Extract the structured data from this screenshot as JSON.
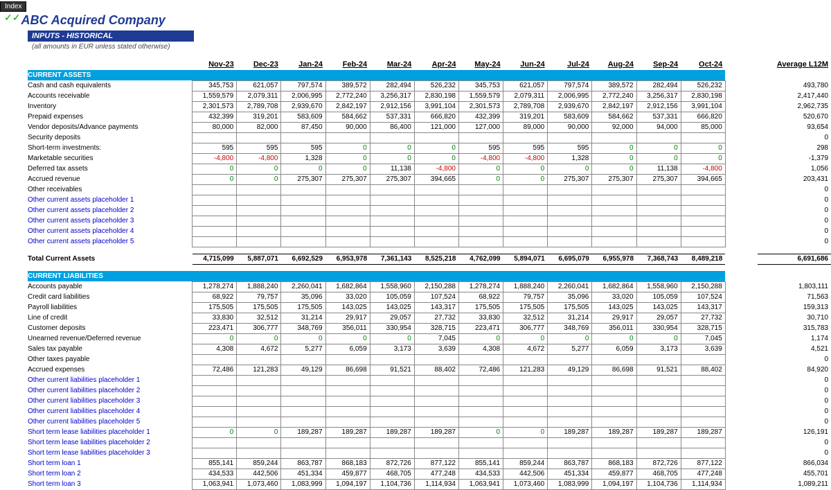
{
  "index_btn": "Index",
  "company": "ABC Acquired Company",
  "section_title": "INPUTS - HISTORICAL",
  "section_sub": "(all amounts in EUR unless stated otherwise)",
  "checks": "✓✓",
  "headers": [
    "Nov-23",
    "Dec-23",
    "Jan-24",
    "Feb-24",
    "Mar-24",
    "Apr-24",
    "May-24",
    "Jun-24",
    "Jul-24",
    "Aug-24",
    "Sep-24",
    "Oct-24"
  ],
  "avg_label": "Average L12M",
  "current_assets_hdr": "CURRENT ASSETS",
  "current_liab_hdr": "CURRENT LIABILITIES",
  "total_ca_label": "Total Current Assets",
  "rows_ca": [
    {
      "label": "Cash and cash equivalents",
      "link": false,
      "vals": [
        "345,753",
        "621,057",
        "797,574",
        "389,572",
        "282,494",
        "526,232",
        "345,753",
        "621,057",
        "797,574",
        "389,572",
        "282,494",
        "526,232"
      ],
      "avg": "493,780"
    },
    {
      "label": "Accounts receivable",
      "link": false,
      "vals": [
        "1,559,579",
        "2,079,311",
        "2,006,995",
        "2,772,240",
        "3,256,317",
        "2,830,198",
        "1,559,579",
        "2,079,311",
        "2,006,995",
        "2,772,240",
        "3,256,317",
        "2,830,198"
      ],
      "avg": "2,417,440"
    },
    {
      "label": "Inventory",
      "link": false,
      "vals": [
        "2,301,573",
        "2,789,708",
        "2,939,670",
        "2,842,197",
        "2,912,156",
        "3,991,104",
        "2,301,573",
        "2,789,708",
        "2,939,670",
        "2,842,197",
        "2,912,156",
        "3,991,104"
      ],
      "avg": "2,962,735"
    },
    {
      "label": "Prepaid expenses",
      "link": false,
      "vals": [
        "432,399",
        "319,201",
        "583,609",
        "584,662",
        "537,331",
        "666,820",
        "432,399",
        "319,201",
        "583,609",
        "584,662",
        "537,331",
        "666,820"
      ],
      "avg": "520,670"
    },
    {
      "label": "Vendor deposits/Advance payments",
      "link": false,
      "vals": [
        "80,000",
        "82,000",
        "87,450",
        "90,000",
        "86,400",
        "121,000",
        "127,000",
        "89,000",
        "90,000",
        "92,000",
        "94,000",
        "85,000"
      ],
      "avg": "93,654"
    },
    {
      "label": "Security deposits",
      "link": false,
      "vals": [
        "",
        "",
        "",
        "",
        "",
        "",
        "",
        "",
        "",
        "",
        "",
        ""
      ],
      "avg": "0"
    },
    {
      "label": "Short-term investments:",
      "link": false,
      "vals": [
        "595",
        "595",
        "595",
        "0",
        "0",
        "0",
        "595",
        "595",
        "595",
        "0",
        "0",
        "0"
      ],
      "avg": "298"
    },
    {
      "label": "Marketable securities",
      "link": false,
      "vals": [
        "-4,800",
        "-4,800",
        "1,328",
        "0",
        "0",
        "0",
        "-4,800",
        "-4,800",
        "1,328",
        "0",
        "0",
        "0"
      ],
      "avg": "-1,379"
    },
    {
      "label": "Deferred tax assets",
      "link": false,
      "vals": [
        "0",
        "0",
        "0",
        "0",
        "11,138",
        "-4,800",
        "0",
        "0",
        "0",
        "0",
        "11,138",
        "-4,800"
      ],
      "avg": "1,056"
    },
    {
      "label": "Accrued revenue",
      "link": false,
      "vals": [
        "0",
        "0",
        "275,307",
        "275,307",
        "275,307",
        "394,665",
        "0",
        "0",
        "275,307",
        "275,307",
        "275,307",
        "394,665"
      ],
      "avg": "203,431"
    },
    {
      "label": "Other receivables",
      "link": false,
      "vals": [
        "",
        "",
        "",
        "",
        "",
        "",
        "",
        "",
        "",
        "",
        "",
        ""
      ],
      "avg": "0"
    },
    {
      "label": "Other current assets placeholder 1",
      "link": true,
      "vals": [
        "",
        "",
        "",
        "",
        "",
        "",
        "",
        "",
        "",
        "",
        "",
        ""
      ],
      "avg": "0"
    },
    {
      "label": "Other current assets placeholder 2",
      "link": true,
      "vals": [
        "",
        "",
        "",
        "",
        "",
        "",
        "",
        "",
        "",
        "",
        "",
        ""
      ],
      "avg": "0"
    },
    {
      "label": "Other current assets placeholder 3",
      "link": true,
      "vals": [
        "",
        "",
        "",
        "",
        "",
        "",
        "",
        "",
        "",
        "",
        "",
        ""
      ],
      "avg": "0"
    },
    {
      "label": "Other current assets placeholder 4",
      "link": true,
      "vals": [
        "",
        "",
        "",
        "",
        "",
        "",
        "",
        "",
        "",
        "",
        "",
        ""
      ],
      "avg": "0"
    },
    {
      "label": "Other current assets placeholder 5",
      "link": true,
      "vals": [
        "",
        "",
        "",
        "",
        "",
        "",
        "",
        "",
        "",
        "",
        "",
        ""
      ],
      "avg": "0"
    }
  ],
  "total_ca": {
    "vals": [
      "4,715,099",
      "5,887,071",
      "6,692,529",
      "6,953,978",
      "7,361,143",
      "8,525,218",
      "4,762,099",
      "5,894,071",
      "6,695,079",
      "6,955,978",
      "7,368,743",
      "8,489,218"
    ],
    "avg": "6,691,686"
  },
  "rows_cl": [
    {
      "label": "Accounts payable",
      "link": false,
      "vals": [
        "1,278,274",
        "1,888,240",
        "2,260,041",
        "1,682,864",
        "1,558,960",
        "2,150,288",
        "1,278,274",
        "1,888,240",
        "2,260,041",
        "1,682,864",
        "1,558,960",
        "2,150,288"
      ],
      "avg": "1,803,111"
    },
    {
      "label": "Credit card liabilities",
      "link": false,
      "vals": [
        "68,922",
        "79,757",
        "35,096",
        "33,020",
        "105,059",
        "107,524",
        "68,922",
        "79,757",
        "35,096",
        "33,020",
        "105,059",
        "107,524"
      ],
      "avg": "71,563"
    },
    {
      "label": "Payroll liabilities",
      "link": false,
      "vals": [
        "175,505",
        "175,505",
        "175,505",
        "143,025",
        "143,025",
        "143,317",
        "175,505",
        "175,505",
        "175,505",
        "143,025",
        "143,025",
        "143,317"
      ],
      "avg": "159,313"
    },
    {
      "label": "Line of credit",
      "link": false,
      "vals": [
        "33,830",
        "32,512",
        "31,214",
        "29,917",
        "29,057",
        "27,732",
        "33,830",
        "32,512",
        "31,214",
        "29,917",
        "29,057",
        "27,732"
      ],
      "avg": "30,710"
    },
    {
      "label": "Customer deposits",
      "link": false,
      "vals": [
        "223,471",
        "306,777",
        "348,769",
        "356,011",
        "330,954",
        "328,715",
        "223,471",
        "306,777",
        "348,769",
        "356,011",
        "330,954",
        "328,715"
      ],
      "avg": "315,783"
    },
    {
      "label": "Unearned revenue/Deferred revenue",
      "link": false,
      "vals": [
        "0",
        "0",
        "0",
        "0",
        "0",
        "7,045",
        "0",
        "0",
        "0",
        "0",
        "0",
        "7,045"
      ],
      "avg": "1,174"
    },
    {
      "label": "Sales tax payable",
      "link": false,
      "vals": [
        "4,308",
        "4,672",
        "5,277",
        "6,059",
        "3,173",
        "3,639",
        "4,308",
        "4,672",
        "5,277",
        "6,059",
        "3,173",
        "3,639"
      ],
      "avg": "4,521"
    },
    {
      "label": "Other taxes payable",
      "link": false,
      "vals": [
        "",
        "",
        "",
        "",
        "",
        "",
        "",
        "",
        "",
        "",
        "",
        ""
      ],
      "avg": "0"
    },
    {
      "label": "Accrued expenses",
      "link": false,
      "vals": [
        "72,486",
        "121,283",
        "49,129",
        "86,698",
        "91,521",
        "88,402",
        "72,486",
        "121,283",
        "49,129",
        "86,698",
        "91,521",
        "88,402"
      ],
      "avg": "84,920"
    },
    {
      "label": "Other current liabilities placeholder 1",
      "link": true,
      "vals": [
        "",
        "",
        "",
        "",
        "",
        "",
        "",
        "",
        "",
        "",
        "",
        ""
      ],
      "avg": "0"
    },
    {
      "label": "Other current liabilities placeholder 2",
      "link": true,
      "vals": [
        "",
        "",
        "",
        "",
        "",
        "",
        "",
        "",
        "",
        "",
        "",
        ""
      ],
      "avg": "0"
    },
    {
      "label": "Other current liabilities placeholder 3",
      "link": true,
      "vals": [
        "",
        "",
        "",
        "",
        "",
        "",
        "",
        "",
        "",
        "",
        "",
        ""
      ],
      "avg": "0"
    },
    {
      "label": "Other current liabilities placeholder 4",
      "link": true,
      "vals": [
        "",
        "",
        "",
        "",
        "",
        "",
        "",
        "",
        "",
        "",
        "",
        ""
      ],
      "avg": "0"
    },
    {
      "label": "Other current liabilities placeholder 5",
      "link": true,
      "vals": [
        "",
        "",
        "",
        "",
        "",
        "",
        "",
        "",
        "",
        "",
        "",
        ""
      ],
      "avg": "0"
    },
    {
      "label": "Short term lease liabilities placeholder 1",
      "link": true,
      "vals": [
        "0",
        "0",
        "189,287",
        "189,287",
        "189,287",
        "189,287",
        "0",
        "0",
        "189,287",
        "189,287",
        "189,287",
        "189,287"
      ],
      "avg": "126,191"
    },
    {
      "label": "Short term lease liabilities placeholder 2",
      "link": true,
      "vals": [
        "",
        "",
        "",
        "",
        "",
        "",
        "",
        "",
        "",
        "",
        "",
        ""
      ],
      "avg": "0"
    },
    {
      "label": "Short term lease liabilities placeholder 3",
      "link": true,
      "vals": [
        "",
        "",
        "",
        "",
        "",
        "",
        "",
        "",
        "",
        "",
        "",
        ""
      ],
      "avg": "0"
    },
    {
      "label": "Short term loan 1",
      "link": true,
      "vals": [
        "855,141",
        "859,244",
        "863,787",
        "868,183",
        "872,726",
        "877,122",
        "855,141",
        "859,244",
        "863,787",
        "868,183",
        "872,726",
        "877,122"
      ],
      "avg": "866,034"
    },
    {
      "label": "Short term loan 2",
      "link": true,
      "vals": [
        "434,533",
        "442,506",
        "451,334",
        "459,877",
        "468,705",
        "477,248",
        "434,533",
        "442,506",
        "451,334",
        "459,877",
        "468,705",
        "477,248"
      ],
      "avg": "455,701"
    },
    {
      "label": "Short term loan 3",
      "link": true,
      "vals": [
        "1,063,941",
        "1,073,460",
        "1,083,999",
        "1,094,197",
        "1,104,736",
        "1,114,934",
        "1,063,941",
        "1,073,460",
        "1,083,999",
        "1,094,197",
        "1,104,736",
        "1,114,934"
      ],
      "avg": "1,089,211"
    }
  ]
}
